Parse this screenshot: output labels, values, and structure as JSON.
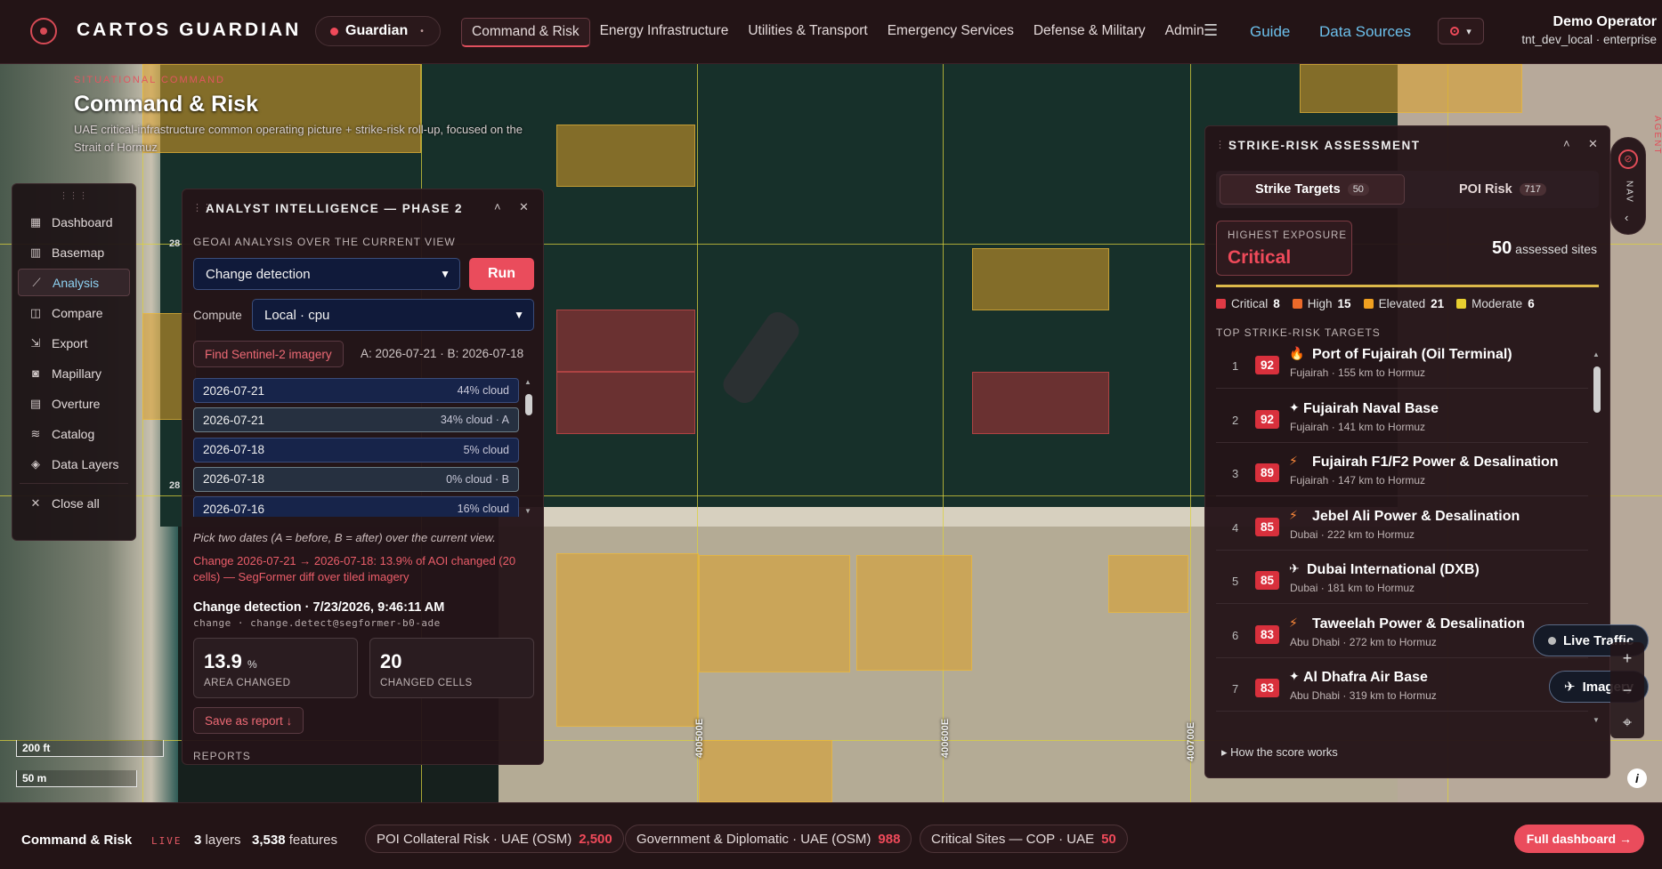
{
  "app": {
    "brand": "CARTOS GUARDIAN",
    "tenant": "Guardian"
  },
  "nav": [
    "Command & Risk",
    "Energy Infrastructure",
    "Utilities & Transport",
    "Emergency Services",
    "Defense & Military",
    "Admin"
  ],
  "top_links": {
    "guide": "Guide",
    "data_sources": "Data Sources"
  },
  "user": {
    "name": "Demo Operator",
    "org": "tnt_dev_local · enterprise"
  },
  "header": {
    "kicker": "SITUATIONAL COMMAND",
    "title": "Command & Risk",
    "subtitle": "UAE critical-infrastructure common operating picture + strike-risk roll-up, focused on the Strait of Hormuz"
  },
  "sidebar": {
    "items": [
      {
        "label": "Dashboard",
        "icon": "dashboard-icon"
      },
      {
        "label": "Basemap",
        "icon": "map-icon"
      },
      {
        "label": "Analysis",
        "icon": "chart-line-icon"
      },
      {
        "label": "Compare",
        "icon": "compare-icon"
      },
      {
        "label": "Export",
        "icon": "export-icon"
      },
      {
        "label": "Mapillary",
        "icon": "camera-icon"
      },
      {
        "label": "Overture",
        "icon": "grid-icon"
      },
      {
        "label": "Catalog",
        "icon": "layers-icon"
      },
      {
        "label": "Data Layers",
        "icon": "data-layers-icon"
      }
    ],
    "close_label": "Close all"
  },
  "analyst": {
    "title": "ANALYST INTELLIGENCE — PHASE 2",
    "kicker": "GEOAI ANALYSIS OVER THE CURRENT VIEW",
    "analysis_value": "Change detection",
    "run_label": "Run",
    "compute_label": "Compute",
    "compute_value": "Local · cpu",
    "find_label": "Find Sentinel-2 imagery",
    "ab_text": "A: 2026-07-21 · B: 2026-07-18",
    "dates": [
      {
        "date": "2026-07-21",
        "cloud": "44% cloud"
      },
      {
        "date": "2026-07-21",
        "cloud": "34% cloud · A"
      },
      {
        "date": "2026-07-18",
        "cloud": "5% cloud"
      },
      {
        "date": "2026-07-18",
        "cloud": "0% cloud · B"
      },
      {
        "date": "2026-07-16",
        "cloud": "16% cloud"
      }
    ],
    "hint": "Pick two dates (A = before, B = after) over the current view.",
    "change_msg": "Change 2026-07-21 → 2026-07-18: 13.9% of AOI changed (20 cells) — SegFormer diff over tiled imagery",
    "report_title": "Change detection · 7/23/2026, 9:46:11 AM",
    "report_meta": "change · change.detect@segformer-b0-ade",
    "area_value": "13.9",
    "area_unit": "%",
    "area_label": "AREA CHANGED",
    "cells_value": "20",
    "cells_label": "CHANGED CELLS",
    "save_label": "Save as report ↓",
    "reports_label": "REPORTS"
  },
  "strike": {
    "title": "STRIKE-RISK ASSESSMENT",
    "tab_targets": "Strike Targets",
    "tab_targets_count": "50",
    "tab_poi": "POI Risk",
    "tab_poi_count": "717",
    "exposure_label": "HIGHEST EXPOSURE",
    "exposure_value": "Critical",
    "assessed_count": "50",
    "assessed_label": "assessed sites",
    "legend": [
      {
        "label": "Critical",
        "count": "8",
        "color": "#e03a45"
      },
      {
        "label": "High",
        "count": "15",
        "color": "#ec6a2a"
      },
      {
        "label": "Elevated",
        "count": "21",
        "color": "#f0a020"
      },
      {
        "label": "Moderate",
        "count": "6",
        "color": "#e8cf30"
      }
    ],
    "top_label": "TOP STRIKE-RISK TARGETS",
    "targets": [
      {
        "rank": "1",
        "score": "92",
        "icon": "fire-icon",
        "glyph": "🔥",
        "name": "Port of Fujairah (Oil Terminal)",
        "sub": "Fujairah · 155 km to Hormuz"
      },
      {
        "rank": "2",
        "score": "92",
        "icon": "naval-icon",
        "glyph": "✦",
        "name": "Fujairah Naval Base",
        "sub": "Fujairah · 141 km to Hormuz"
      },
      {
        "rank": "3",
        "score": "89",
        "icon": "power-icon",
        "glyph": "⚡",
        "name": "Fujairah F1/F2 Power & Desalination",
        "sub": "Fujairah · 147 km to Hormuz"
      },
      {
        "rank": "4",
        "score": "85",
        "icon": "power-icon",
        "glyph": "⚡",
        "name": "Jebel Ali Power & Desalination",
        "sub": "Dubai · 222 km to Hormuz"
      },
      {
        "rank": "5",
        "score": "85",
        "icon": "airplane-icon",
        "glyph": "✈",
        "name": "Dubai International (DXB)",
        "sub": "Dubai · 181 km to Hormuz"
      },
      {
        "rank": "6",
        "score": "83",
        "icon": "power-icon",
        "glyph": "⚡",
        "name": "Taweelah Power & Desalination",
        "sub": "Abu Dhabi · 272 km to Hormuz"
      },
      {
        "rank": "7",
        "score": "83",
        "icon": "airbase-icon",
        "glyph": "✦",
        "name": "Al Dhafra Air Base",
        "sub": "Abu Dhabi · 319 km to Hormuz"
      }
    ],
    "how_label": "▸ How the score works"
  },
  "rail": {
    "label": "NAV",
    "agent": "AGENT"
  },
  "map": {
    "live_traffic": "Live Traffic",
    "imagery": "Imagery",
    "scale_ft": "200 ft",
    "scale_m": "50 m",
    "utm_1": "400500E",
    "utm_2": "400600E",
    "utm_3": "400700E",
    "grid_l1": "28",
    "grid_l2": "28"
  },
  "bottom": {
    "title": "Command & Risk",
    "live": "LIVE",
    "layers_count": "3",
    "layers_label": "layers",
    "features_count": "3,538",
    "features_label": "features",
    "chips": [
      {
        "label": "POI Collateral Risk · UAE (OSM)",
        "count": "2,500"
      },
      {
        "label": "Government & Diplomatic · UAE (OSM)",
        "count": "988"
      },
      {
        "label": "Critical Sites — COP · UAE",
        "count": "50"
      }
    ],
    "full_label": "Full dashboard →"
  }
}
